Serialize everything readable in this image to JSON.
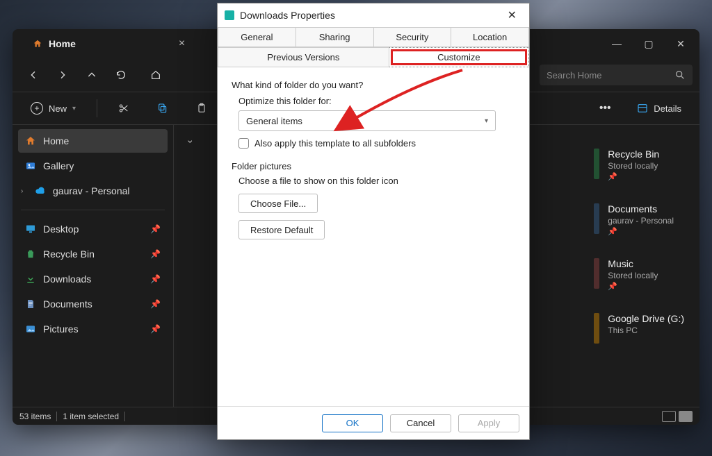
{
  "explorer": {
    "tab_label": "Home",
    "search_placeholder": "Search Home",
    "new_label": "New",
    "details_label": "Details",
    "sidebar": [
      {
        "label": "Home",
        "icon": "home",
        "selected": true
      },
      {
        "label": "Gallery",
        "icon": "gallery"
      },
      {
        "label": "gaurav - Personal",
        "icon": "onedrive",
        "chevron": true
      }
    ],
    "favorites": [
      {
        "label": "Desktop",
        "icon": "desktop"
      },
      {
        "label": "Recycle Bin",
        "icon": "recycle"
      },
      {
        "label": "Downloads",
        "icon": "download"
      },
      {
        "label": "Documents",
        "icon": "document"
      },
      {
        "label": "Pictures",
        "icon": "pictures"
      }
    ],
    "main_cards": [
      {
        "title": "Recycle Bin",
        "subtitle": "Stored locally",
        "pin": true
      },
      {
        "title": "Documents",
        "subtitle": "gaurav - Personal",
        "pin": true
      },
      {
        "title": "Music",
        "subtitle": "Stored locally",
        "pin": true
      },
      {
        "title": "Google Drive (G:)",
        "subtitle": "This PC",
        "pin": false
      }
    ],
    "status_items": "53 items",
    "status_selected": "1 item selected"
  },
  "dialog": {
    "title": "Downloads Properties",
    "tabs_row1": [
      "General",
      "Sharing",
      "Security",
      "Location"
    ],
    "tabs_row2": [
      "Previous Versions",
      "Customize"
    ],
    "active_tab": "Customize",
    "group1_title": "What kind of folder do you want?",
    "optimize_label": "Optimize this folder for:",
    "optimize_value": "General items",
    "subfolder_checkbox": "Also apply this template to all subfolders",
    "group2_title": "Folder pictures",
    "group2_sub": "Choose a file to show on this folder icon",
    "choose_file_btn": "Choose File...",
    "restore_btn": "Restore Default",
    "ok": "OK",
    "cancel": "Cancel",
    "apply": "Apply"
  }
}
